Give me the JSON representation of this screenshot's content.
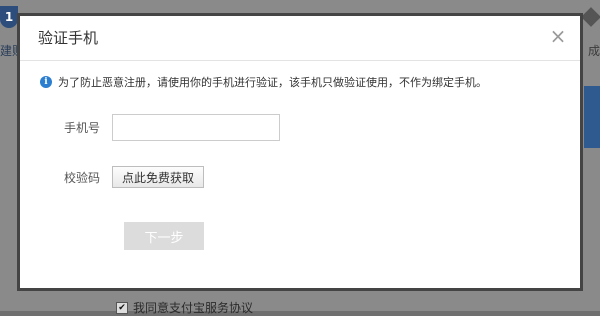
{
  "background": {
    "step1_number": "1",
    "step1_label": "建账",
    "right_step_label": "成",
    "agree_checkbox_mark": "✔",
    "agree_text": "我同意支付宝服务协议"
  },
  "dialog": {
    "title": "验证手机",
    "close_glyph": "×",
    "notice_icon_glyph": "i",
    "notice_text": "为了防止恶意注册，请使用你的手机进行验证，该手机只做验证使用，不作为绑定手机。",
    "phone_label": "手机号",
    "phone_value": "",
    "phone_placeholder": "",
    "code_label": "校验码",
    "get_code_button": "点此免费获取",
    "next_button": "下一步"
  },
  "colors": {
    "info_icon": "#2b7ed0",
    "overlay": "#6f6f6f",
    "next_button_disabled": "#dcdcdc"
  }
}
